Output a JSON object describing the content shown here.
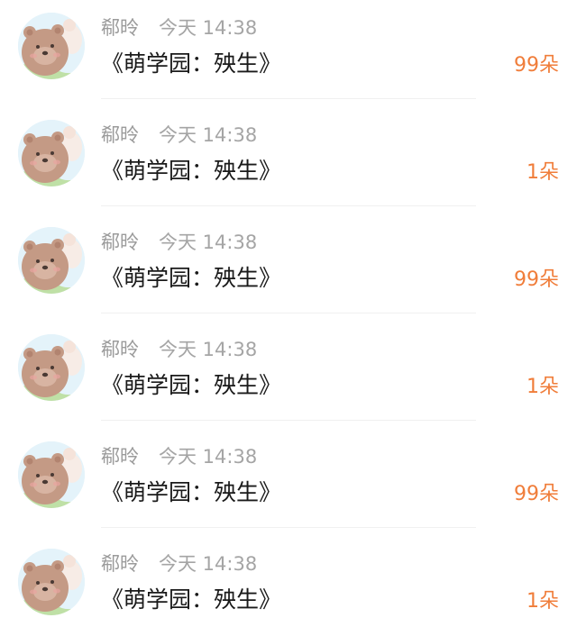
{
  "colors": {
    "username": "#9b9b9b",
    "timestamp": "#a5a5a5",
    "title": "#1a1a1a",
    "amount": "#f07d3a",
    "divider": "#f0f0f0"
  },
  "rows": [
    {
      "avatar_icon": "bear-avatar-icon",
      "username": "郗昤",
      "time": "今天 14:38",
      "title": "《萌学园：殃生》",
      "amount": "99朵"
    },
    {
      "avatar_icon": "bear-avatar-icon",
      "username": "郗昤",
      "time": "今天 14:38",
      "title": "《萌学园：殃生》",
      "amount": "1朵"
    },
    {
      "avatar_icon": "bear-avatar-icon",
      "username": "郗昤",
      "time": "今天 14:38",
      "title": "《萌学园：殃生》",
      "amount": "99朵"
    },
    {
      "avatar_icon": "bear-avatar-icon",
      "username": "郗昤",
      "time": "今天 14:38",
      "title": "《萌学园：殃生》",
      "amount": "1朵"
    },
    {
      "avatar_icon": "bear-avatar-icon",
      "username": "郗昤",
      "time": "今天 14:38",
      "title": "《萌学园：殃生》",
      "amount": "99朵"
    },
    {
      "avatar_icon": "bear-avatar-icon",
      "username": "郗昤",
      "time": "今天 14:38",
      "title": "《萌学园：殃生》",
      "amount": "1朵"
    }
  ]
}
